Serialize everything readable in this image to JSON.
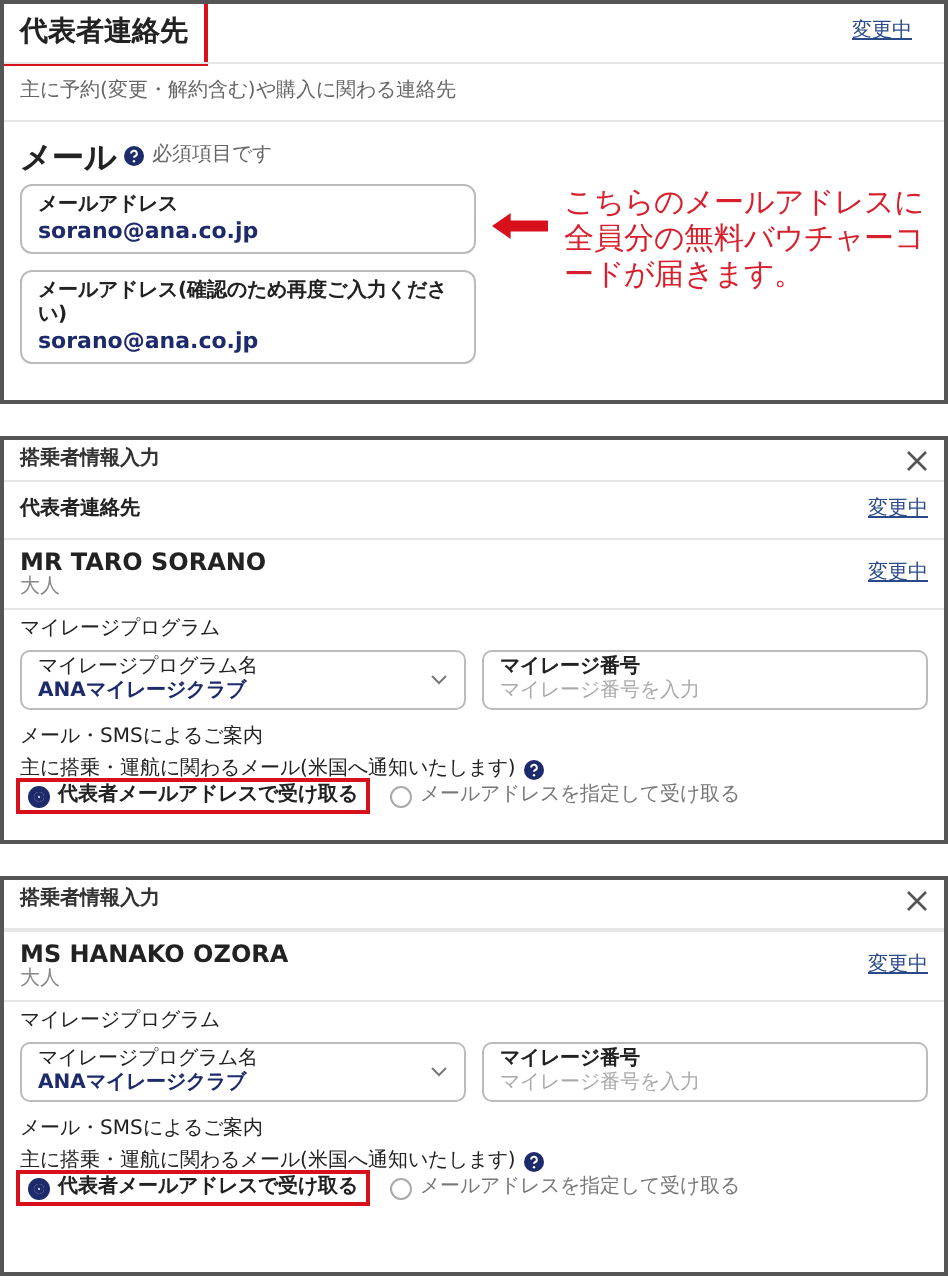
{
  "panels": [
    {
      "kind": "contact",
      "heading": {
        "text": "代表者連絡先",
        "highlighted": true
      },
      "action": "変更中",
      "description": "主に予約(変更・解約含む)や購入に関わる連絡先",
      "mail_label": "メール",
      "required_note": "必須項目です",
      "fields": [
        {
          "label": "メールアドレス",
          "value": "sorano@ana.co.jp"
        },
        {
          "label": "メールアドレス(確認のため再度ご入力ください)",
          "value": "sorano@ana.co.jp"
        }
      ],
      "annotation": "こちらのメールアドレスに全員分の無料バウチャーコードが届きます。"
    },
    {
      "kind": "passenger",
      "title": "搭乗者情報入力",
      "representative": {
        "title": "代表者連絡先",
        "action": "変更中"
      },
      "passenger": {
        "name": "MR TARO SORANO",
        "type": "大人",
        "action": "変更中"
      },
      "mileage": {
        "heading": "マイレージプログラム",
        "program": {
          "label": "マイレージプログラム名",
          "value": "ANAマイレージクラブ"
        },
        "number": {
          "label": "マイレージ番号",
          "placeholder": "マイレージ番号を入力"
        }
      },
      "notice": {
        "heading": "メール・SMSによるご案内",
        "note": "主に搭乗・運航に関わるメール(米国へ通知いたします)",
        "options": [
          {
            "label": "代表者メールアドレスで受け取る",
            "selected": true,
            "highlighted": true
          },
          {
            "label": "メールアドレスを指定して受け取る",
            "selected": false,
            "highlighted": false
          }
        ]
      }
    },
    {
      "kind": "passenger",
      "title": "搭乗者情報入力",
      "passenger": {
        "name": "MS HANAKO OZORA",
        "type": "大人",
        "action": "変更中"
      },
      "mileage": {
        "heading": "マイレージプログラム",
        "program": {
          "label": "マイレージプログラム名",
          "value": "ANAマイレージクラブ"
        },
        "number": {
          "label": "マイレージ番号",
          "placeholder": "マイレージ番号を入力"
        }
      },
      "notice": {
        "heading": "メール・SMSによるご案内",
        "note": "主に搭乗・運航に関わるメール(米国へ通知いたします)",
        "options": [
          {
            "label": "代表者メールアドレスで受け取る",
            "selected": true,
            "highlighted": true
          },
          {
            "label": "メールアドレスを指定して受け取る",
            "selected": false,
            "highlighted": false
          }
        ]
      }
    }
  ]
}
